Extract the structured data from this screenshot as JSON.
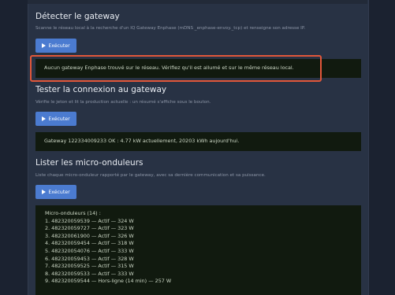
{
  "sections": {
    "detect": {
      "title": "Détecter le gateway",
      "description": "Scanne le réseau local à la recherche d'un IQ Gateway Enphase (mDNS _enphase-envoy._tcp) et renseigne son adresse IP.",
      "button_label": "Exécuter",
      "output": "Aucun gateway Enphase trouvé sur le réseau. Vérifiez qu'il est allumé et sur le même réseau local."
    },
    "test": {
      "title": "Tester la connexion au gateway",
      "description": "Vérifie le jeton et lit la production actuelle : un résumé s'affiche sous le bouton.",
      "button_label": "Exécuter",
      "output": "Gateway 122334009233 OK : 4.77 kW actuellement, 20203 kWh aujourd'hui."
    },
    "list": {
      "title": "Lister les micro-onduleurs",
      "description": "Liste chaque micro-onduleur rapporté par le gateway, avec sa dernière communication et sa puissance.",
      "button_label": "Exécuter",
      "output_header": "Micro-onduleurs (14) :",
      "output_lines": [
        "1. 482320059539 — Actif — 324 W",
        "2. 482320059727 — Actif — 323 W",
        "3. 482320061900 — Actif — 326 W",
        "4. 482320059454 — Actif — 318 W",
        "5. 482320054076 — Actif — 333 W",
        "6. 482320059453 — Actif — 328 W",
        "7. 482320059525 — Actif — 315 W",
        "8. 482320059533 — Actif — 333 W",
        "9. 482320059544 — Hors-ligne (14 min) — 257 W"
      ]
    }
  },
  "colors": {
    "background": "#1b2230",
    "card": "#283244",
    "button": "#4b7bd0",
    "output_bg": "#111a0f",
    "highlight": "#e2573a"
  },
  "icons": {
    "run_button": "play-icon"
  }
}
